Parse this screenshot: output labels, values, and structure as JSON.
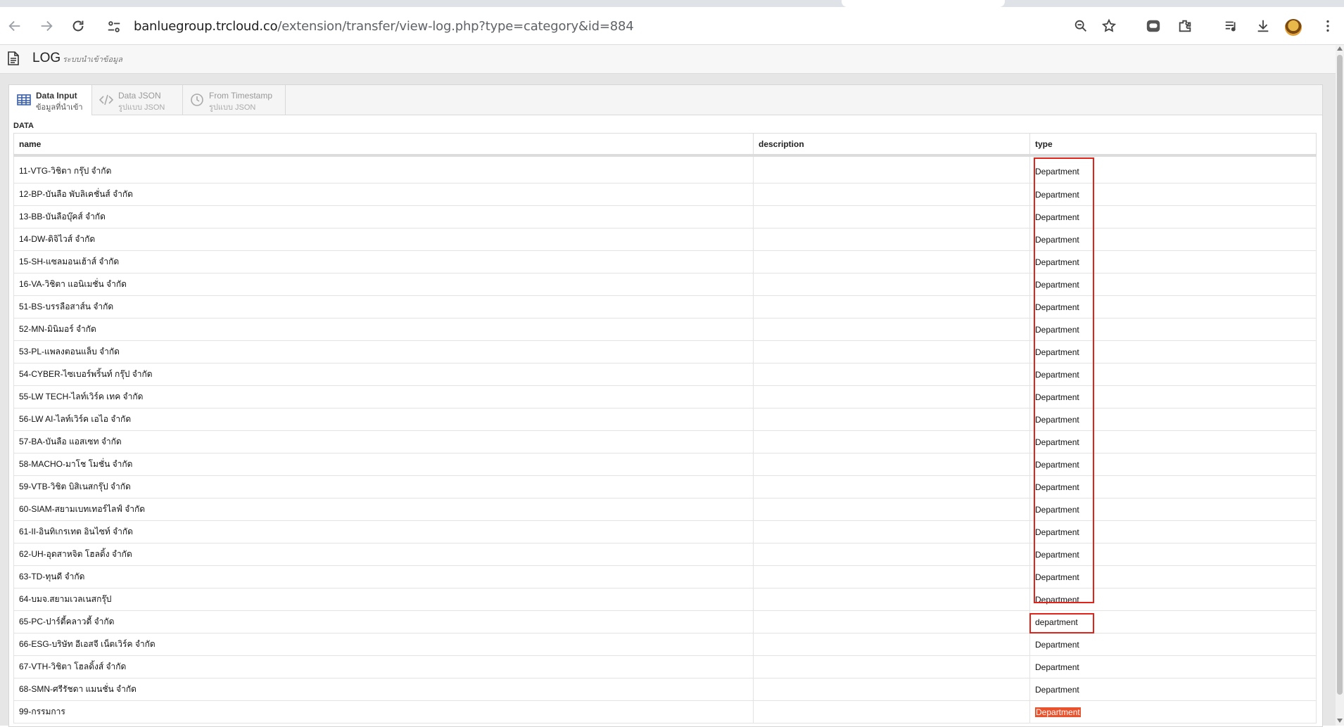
{
  "browser": {
    "url_host": "banluegroup.trcloud.co",
    "url_path": "/extension/transfer/view-log.php?type=category&id=884",
    "icons": [
      "back-icon",
      "forward-icon",
      "reload-icon",
      "site-info-icon",
      "zoom-icon",
      "star-icon",
      "line-icon",
      "extensions-icon",
      "media-icon",
      "download-icon",
      "profile-avatar",
      "more-icon"
    ]
  },
  "header": {
    "title": "LOG",
    "subtitle": "ระบบนำเข้าข้อมูล"
  },
  "tabs": [
    {
      "label": "Data Input",
      "sub": "ข้อมูลที่นำเข้า",
      "icon": "table-icon",
      "active": true
    },
    {
      "label": "Data JSON",
      "sub": "รูปแบบ JSON",
      "icon": "code-icon",
      "active": false
    },
    {
      "label": "From Timestamp",
      "sub": "รูปแบบ JSON",
      "icon": "clock-icon",
      "active": false
    }
  ],
  "section_label": "DATA",
  "table": {
    "columns": [
      "name",
      "description",
      "type"
    ],
    "rows": [
      {
        "name": "11-VTG-วิชิตา กรุ๊ป จำกัด",
        "description": "",
        "type": "Department"
      },
      {
        "name": "12-BP-บันลือ พับลิเคชั่นส์ จำกัด",
        "description": "",
        "type": "Department"
      },
      {
        "name": "13-BB-บันลือบุ๊คส์ จำกัด",
        "description": "",
        "type": "Department"
      },
      {
        "name": "14-DW-ดิจิไวส์ จำกัด",
        "description": "",
        "type": "Department"
      },
      {
        "name": "15-SH-แซลมอนเฮ้าส์ จำกัด",
        "description": "",
        "type": "Department"
      },
      {
        "name": "16-VA-วิชิตา แอนิเมชั่น จำกัด",
        "description": "",
        "type": "Department"
      },
      {
        "name": "51-BS-บรรลือสาส์น จำกัด",
        "description": "",
        "type": "Department"
      },
      {
        "name": "52-MN-มินิมอร์ จำกัด",
        "description": "",
        "type": "Department"
      },
      {
        "name": "53-PL-แพลงตอนแล็บ จำกัด",
        "description": "",
        "type": "Department"
      },
      {
        "name": "54-CYBER-ไซเบอร์พริ้นท์ กรุ๊ป จำกัด",
        "description": "",
        "type": "Department"
      },
      {
        "name": "55-LW TECH-ไลท์เวิร์ค เทค จำกัด",
        "description": "",
        "type": "Department"
      },
      {
        "name": "56-LW AI-ไลท์เวิร์ค เอไอ จำกัด",
        "description": "",
        "type": "Department"
      },
      {
        "name": "57-BA-บันลือ แอสเซท จำกัด",
        "description": "",
        "type": "Department"
      },
      {
        "name": "58-MACHO-มาโช โมชั่น จำกัด",
        "description": "",
        "type": "Department"
      },
      {
        "name": "59-VTB-วิชิต บิสิเนสกรุ๊ป จำกัด",
        "description": "",
        "type": "Department"
      },
      {
        "name": "60-SIAM-สยามเบทเทอร์ไลฟ์ จำกัด",
        "description": "",
        "type": "Department"
      },
      {
        "name": "61-II-อินทิเกรเทต อินไซท์ จำกัด",
        "description": "",
        "type": "Department"
      },
      {
        "name": "62-UH-อุดสาหจิต โฮลดิ้ง จำกัด",
        "description": "",
        "type": "Department"
      },
      {
        "name": "63-TD-ทุนดี จำกัด",
        "description": "",
        "type": "Department"
      },
      {
        "name": "64-บมจ.สยามเวลเนสกรุ๊ป",
        "description": "",
        "type": "Department"
      },
      {
        "name": "65-PC-ปาร์ตี้คลาวดี้ จำกัด",
        "description": "",
        "type": "department"
      },
      {
        "name": "66-ESG-บริษัท อีเอสจี เน็ตเวิร์ค จำกัด",
        "description": "",
        "type": "Department"
      },
      {
        "name": "67-VTH-วิชิตา โฮลดิ้งส์ จำกัด",
        "description": "",
        "type": "Department"
      },
      {
        "name": "68-SMN-ศรีรัชดา แมนชั่น จำกัด",
        "description": "",
        "type": "Department"
      },
      {
        "name": "99-กรรมการ",
        "description": "",
        "type": "Department"
      }
    ]
  },
  "colors": {
    "annotation_box": "#e2231a",
    "selected_text_bg": "#e8522d",
    "page_bg": "#e6e6e6"
  }
}
